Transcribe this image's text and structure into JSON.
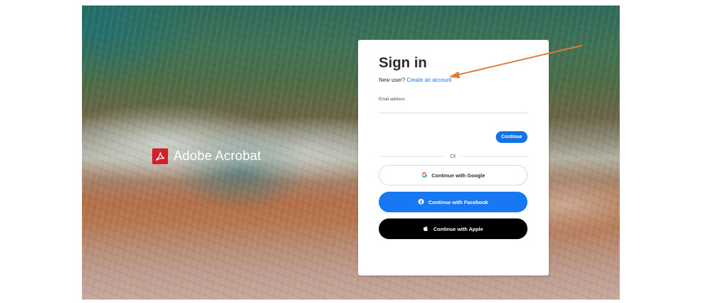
{
  "brand": {
    "name": "Adobe Acrobat",
    "logo_icon": "acrobat-logo-icon",
    "logo_color": "#d4202b"
  },
  "signin": {
    "title": "Sign in",
    "new_user_text": "New user?",
    "create_account_link": "Create an account",
    "email_label": "Email address",
    "email_value": "",
    "continue_label": "Continue",
    "or_label": "Or",
    "google_label": "Continue with Google",
    "facebook_label": "Continue with Facebook",
    "apple_label": "Continue with Apple"
  },
  "colors": {
    "accent": "#1473e6",
    "facebook": "#1877f2",
    "apple": "#000000",
    "annotation_arrow": "#e07b39"
  }
}
